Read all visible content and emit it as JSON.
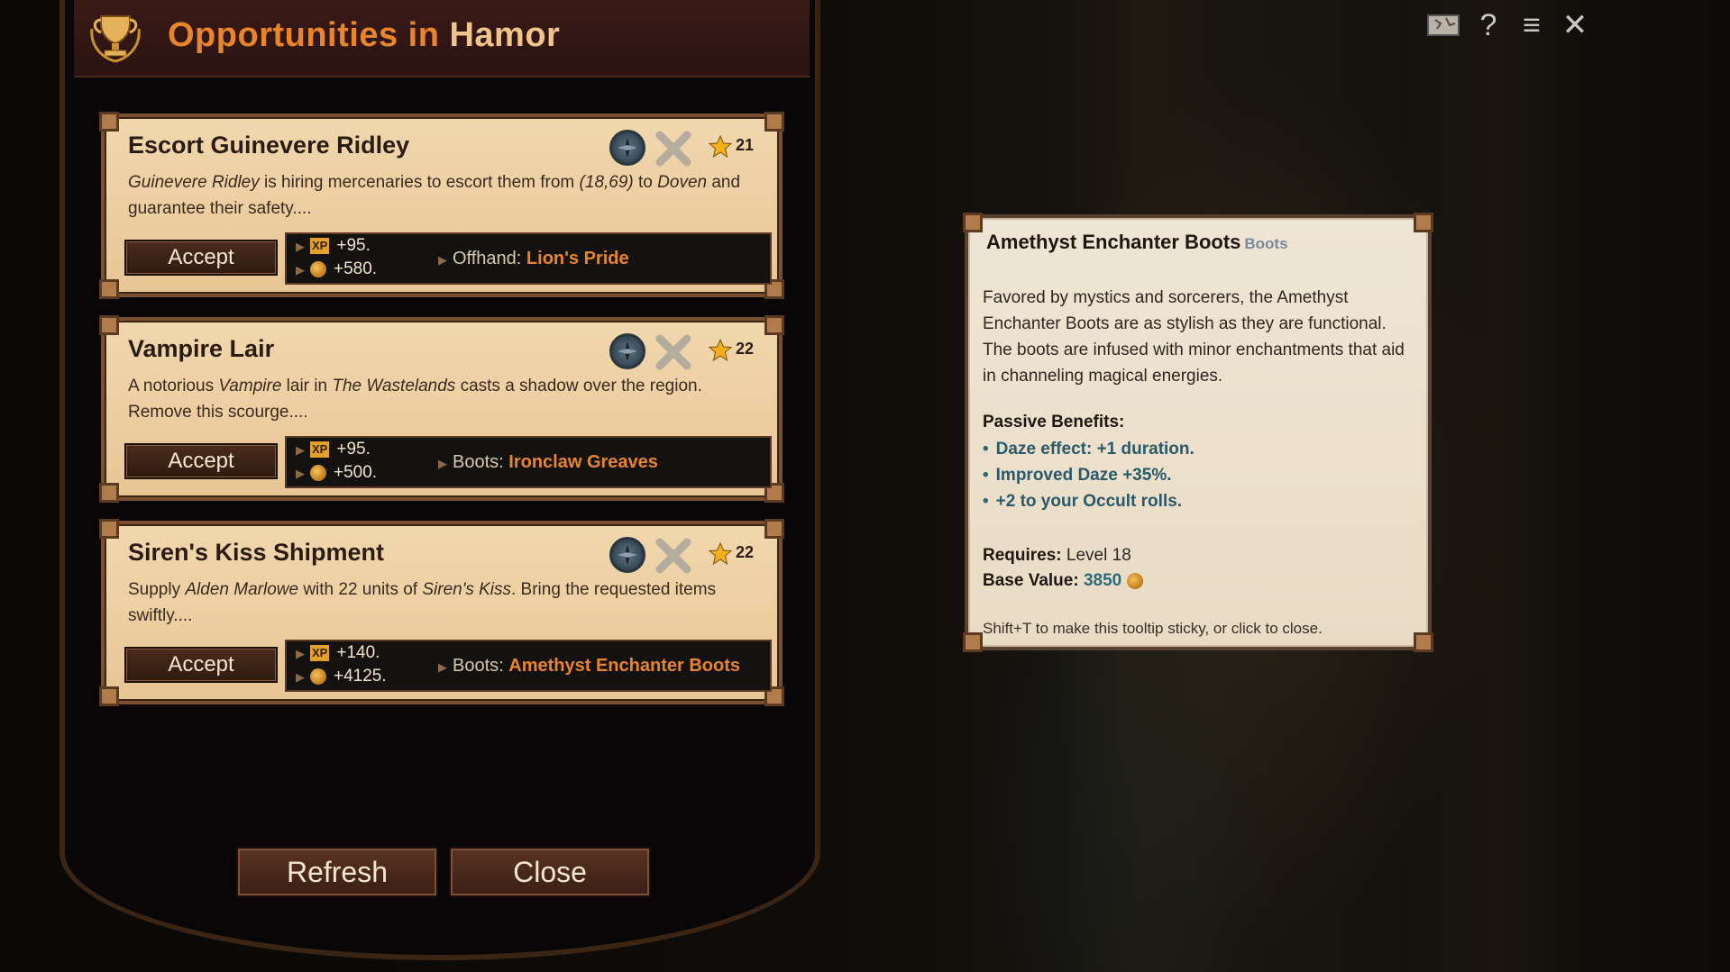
{
  "panel": {
    "title_prefix": "Opportunities in ",
    "title_place": "Hamor"
  },
  "quests": [
    {
      "title": "Escort Guinevere Ridley",
      "level": "21",
      "desc_html": "<i>Guinevere Ridley</i> is hiring mercenaries to escort them from <i>(18,69)</i> to <i>Doven</i> and guarantee their safety....",
      "accept": "Accept",
      "xp": "+95.",
      "gold": "+580.",
      "item_slot": "Offhand:",
      "item_name": "Lion's Pride"
    },
    {
      "title": "Vampire Lair",
      "level": "22",
      "desc_html": "A notorious <i>Vampire</i> lair in <i>The Wastelands</i> casts a shadow over the region. Remove this scourge....",
      "accept": "Accept",
      "xp": "+95.",
      "gold": "+500.",
      "item_slot": "Boots:",
      "item_name": "Ironclaw Greaves"
    },
    {
      "title": "Siren's Kiss Shipment",
      "level": "22",
      "desc_html": "Supply <i>Alden Marlowe</i> with 22 units of <i>Siren's Kiss</i>. Bring the requested items swiftly....",
      "accept": "Accept",
      "xp": "+140.",
      "gold": "+4125.",
      "item_slot": "Boots:",
      "item_name": "Amethyst Enchanter Boots"
    }
  ],
  "xp_badge": "XP",
  "buttons": {
    "refresh": "Refresh",
    "close": "Close"
  },
  "tooltip": {
    "name": "Amethyst Enchanter Boots",
    "type": "Boots",
    "description": "Favored by mystics and sorcerers, the Amethyst Enchanter Boots are as stylish as they are functional. The boots are infused with minor enchantments that aid in channeling magical energies.",
    "passive_header": "Passive Benefits:",
    "benefits": [
      "Daze effect: +1 duration.",
      "Improved Daze +35%.",
      "+2 to your Occult rolls."
    ],
    "requires_label": "Requires:",
    "requires_value": "Level 18",
    "value_label": "Base Value:",
    "value_amount": "3850",
    "hint": "Shift+T to make this tooltip sticky, or click to close."
  },
  "top_icons": {
    "help": "?",
    "menu": "≡",
    "close": "✕"
  }
}
